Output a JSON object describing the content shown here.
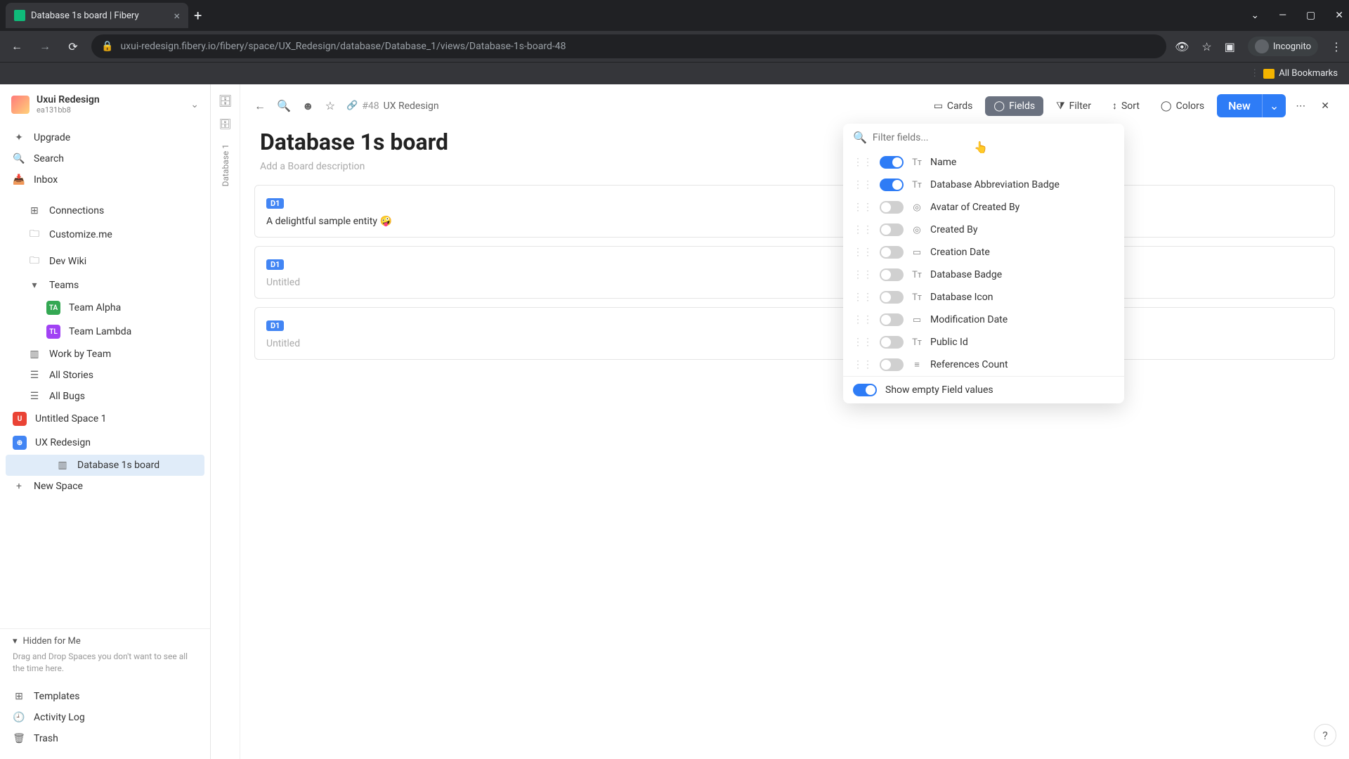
{
  "browser": {
    "tab_title": "Database 1s board | Fibery",
    "url": "uxui-redesign.fibery.io/fibery/space/UX_Redesign/database/Database_1/views/Database-1s-board-48",
    "incognito_label": "Incognito",
    "bookmarks_label": "All Bookmarks"
  },
  "workspace": {
    "name": "Uxui Redesign",
    "sub": "ea131bb8"
  },
  "nav": {
    "upgrade": "Upgrade",
    "search": "Search",
    "inbox": "Inbox"
  },
  "tree": {
    "connections": "Connections",
    "customize": "Customize.me",
    "devwiki": "Dev Wiki",
    "teams": "Teams",
    "team_alpha": "Team Alpha",
    "team_lambda": "Team Lambda",
    "work_by_team": "Work by Team",
    "all_stories": "All Stories",
    "all_bugs": "All Bugs",
    "untitled_space": "Untitled Space 1",
    "ux_redesign": "UX Redesign",
    "db1_board": "Database 1s board",
    "new_space": "New Space"
  },
  "hidden": {
    "title": "Hidden for Me",
    "hint": "Drag and Drop Spaces you don't want to see all the time here."
  },
  "bottom": {
    "templates": "Templates",
    "activity": "Activity Log",
    "trash": "Trash"
  },
  "vert": {
    "label": "Database 1"
  },
  "crumb": {
    "id": "#48",
    "space": "UX Redesign"
  },
  "toolbar": {
    "cards": "Cards",
    "fields": "Fields",
    "filter": "Filter",
    "sort": "Sort",
    "colors": "Colors",
    "new": "New"
  },
  "page": {
    "title": "Database 1s board",
    "desc_placeholder": "Add a Board description"
  },
  "cards": [
    {
      "badge": "D1",
      "text": "A delightful sample entity 🤪",
      "muted": false
    },
    {
      "badge": "D1",
      "text": "Untitled",
      "muted": true
    },
    {
      "badge": "D1",
      "text": "Untitled",
      "muted": true
    }
  ],
  "popover": {
    "search_placeholder": "Filter fields...",
    "fields": [
      {
        "label": "Name",
        "on": true,
        "icon": "Tᴛ"
      },
      {
        "label": "Database Abbreviation Badge",
        "on": true,
        "icon": "Tᴛ"
      },
      {
        "label": "Avatar of Created By",
        "on": false,
        "icon": "◎"
      },
      {
        "label": "Created By",
        "on": false,
        "icon": "◎"
      },
      {
        "label": "Creation Date",
        "on": false,
        "icon": "▭"
      },
      {
        "label": "Database Badge",
        "on": false,
        "icon": "Tᴛ"
      },
      {
        "label": "Database Icon",
        "on": false,
        "icon": "Tᴛ"
      },
      {
        "label": "Modification Date",
        "on": false,
        "icon": "▭"
      },
      {
        "label": "Public Id",
        "on": false,
        "icon": "Tᴛ"
      },
      {
        "label": "References Count",
        "on": false,
        "icon": "≡"
      }
    ],
    "footer_label": "Show empty Field values",
    "footer_on": true
  }
}
